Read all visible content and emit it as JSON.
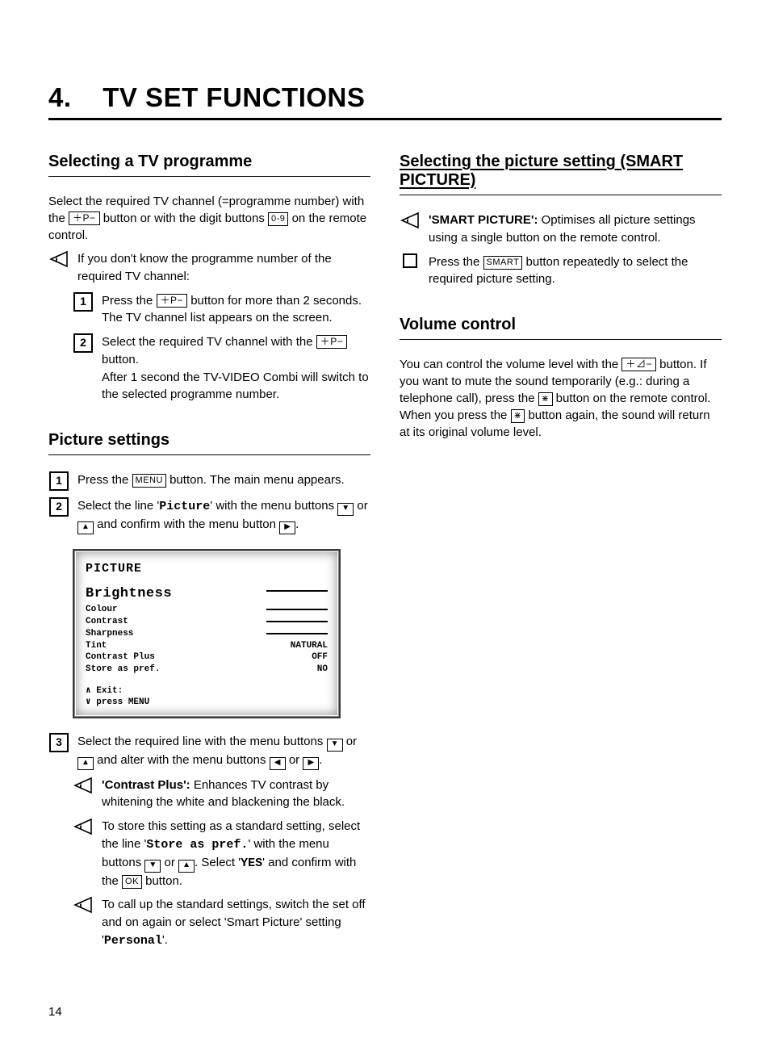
{
  "chapter": {
    "number": "4.",
    "title": "TV SET FUNCTIONS"
  },
  "buttons": {
    "p_plus_minus": "＋P−",
    "digits": "0-9",
    "menu": "MENU",
    "ok": "OK",
    "smart": "SMART",
    "vol": "＋⊿−",
    "mute": "⋇"
  },
  "left": {
    "s1": {
      "heading": "Selecting a TV programme",
      "intro_a": "Select the required TV channel (=programme number) with the ",
      "intro_b": " button or with the digit buttons ",
      "intro_c": " on the remote control.",
      "tip": "If you don't know the programme number of the required TV channel:",
      "step1_a": "Press the ",
      "step1_b": " button for more than 2 seconds. The TV channel list appears on the screen.",
      "step2_a": "Select the required TV channel with the ",
      "step2_b": " button.",
      "step2_c": "After 1 second the TV-VIDEO Combi will switch to the selected programme number."
    },
    "s2": {
      "heading": "Picture settings",
      "step1_a": "Press the ",
      "step1_b": " button. The main menu appears.",
      "step2_a": "Select the line '",
      "step2_word": "Picture",
      "step2_b": "' with the menu buttons ",
      "step2_c": " or ",
      "step2_d": " and confirm with the menu button ",
      "step2_e": ".",
      "osd": {
        "title": "PICTURE",
        "rows": [
          {
            "label": "Brightness",
            "big": true,
            "slider": true
          },
          {
            "label": "Colour",
            "slider": true
          },
          {
            "label": "Contrast",
            "slider": true
          },
          {
            "label": "Sharpness",
            "slider": true
          },
          {
            "label": "Tint",
            "value": "NATURAL"
          },
          {
            "label": "Contrast Plus",
            "value": "OFF"
          },
          {
            "label": "Store as pref.",
            "value": "NO"
          }
        ],
        "foot1": "∧ Exit:",
        "foot2": "∨ press MENU"
      },
      "step3_a": "Select the required line with the menu buttons ",
      "step3_b": " or ",
      "step3_c": " and alter with the menu buttons ",
      "step3_d": " or ",
      "step3_e": ".",
      "tip1_lead": "'Contrast Plus':",
      "tip1": " Enhances TV contrast by whitening the white and blackening the black.",
      "tip2_a": "To store this setting as a standard setting, select the line '",
      "tip2_word": "Store as pref.",
      "tip2_b": "' with the menu buttons ",
      "tip2_c": " or ",
      "tip2_d": ". Select '",
      "tip2_word2": "YES",
      "tip2_e": "' and confirm with the ",
      "tip2_f": " button.",
      "tip3_a": "To call up the standard settings, switch the set off and on again or select 'Smart Picture' setting '",
      "tip3_word": "Personal",
      "tip3_b": "'."
    }
  },
  "right": {
    "s1": {
      "heading": "Selecting the picture setting (SMART PICTURE)",
      "tip_lead": "'SMART PICTURE':",
      "tip": " Optimises all picture settings using a single button on the remote control.",
      "step_a": "Press the ",
      "step_b": " button repeatedly to select the required picture setting."
    },
    "s2": {
      "heading": "Volume control",
      "p_a": "You can control the volume level with the ",
      "p_b": " button. If you want to mute the sound temporarily (e.g.: during a telephone call), press the ",
      "p_c": " button on the remote control. When you press the ",
      "p_d": " button again, the sound will return at its original volume level."
    }
  },
  "page_number": "14"
}
